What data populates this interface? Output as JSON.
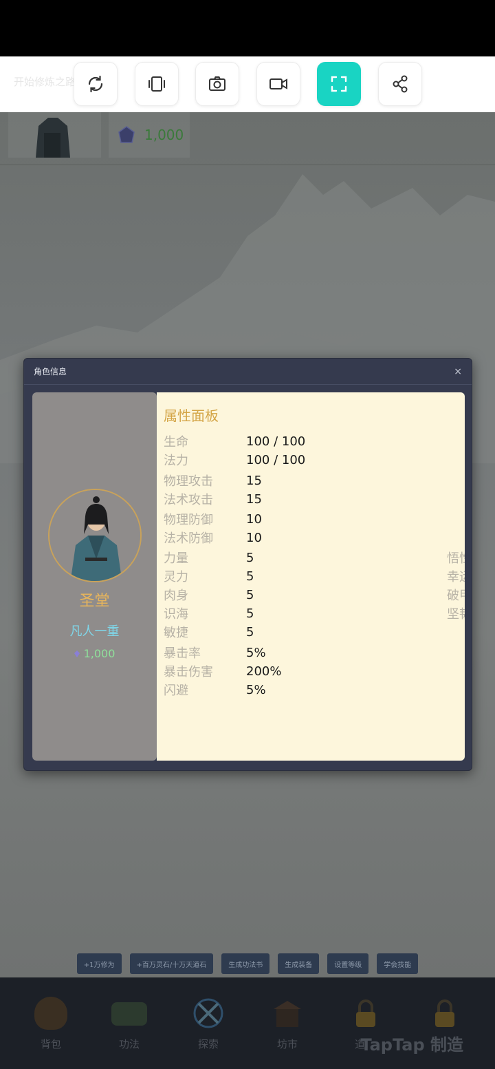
{
  "toolbar": {
    "ghost_text": "开始修炼之路",
    "buttons": [
      {
        "name": "refresh",
        "icon": "refresh-icon"
      },
      {
        "name": "rotate",
        "icon": "rotate-device-icon"
      },
      {
        "name": "screenshot",
        "icon": "camera-icon"
      },
      {
        "name": "record",
        "icon": "video-icon"
      },
      {
        "name": "fullscreen",
        "icon": "fullscreen-icon",
        "active": true
      },
      {
        "name": "share",
        "icon": "share-icon"
      }
    ],
    "accent": "#19d4c3"
  },
  "top_bar": {
    "currency_value": "1,000"
  },
  "modal": {
    "title": "角色信息",
    "close_glyph": "×",
    "character": {
      "name": "圣堂",
      "realm": "凡人一重",
      "spirit_stone": "1,000"
    },
    "panel_title": "属性面板",
    "stats": [
      {
        "label": "生命",
        "value": "100 / 100"
      },
      {
        "label": "法力",
        "value": "100 / 100"
      },
      {
        "label": "物理攻击",
        "value": "15"
      },
      {
        "label": "法术攻击",
        "value": "15"
      },
      {
        "label": "物理防御",
        "value": "10"
      },
      {
        "label": "法术防御",
        "value": "10"
      },
      {
        "label": "力量",
        "value": "5"
      },
      {
        "label": "灵力",
        "value": "5"
      },
      {
        "label": "肉身",
        "value": "5"
      },
      {
        "label": "识海",
        "value": "5"
      },
      {
        "label": "敏捷",
        "value": "5"
      },
      {
        "label": "暴击率",
        "value": "5%"
      },
      {
        "label": "暴击伤害",
        "value": "200%"
      },
      {
        "label": "闪避",
        "value": "5%"
      }
    ],
    "side_stats": [
      "悟性",
      "幸运",
      "破甲",
      "坚韧"
    ]
  },
  "cheat_buttons": [
    "+1万修为",
    "+百万灵石/十万天道石",
    "生成功法书",
    "生成装备",
    "设置等级",
    "学会技能"
  ],
  "bottom_nav": [
    {
      "label": "背包",
      "icon": "bag-icon"
    },
    {
      "label": "功法",
      "icon": "scroll-icon"
    },
    {
      "label": "探索",
      "icon": "crossed-swords-icon"
    },
    {
      "label": "坊市",
      "icon": "market-icon"
    },
    {
      "label": "道",
      "icon": "lock-icon"
    },
    {
      "label": "",
      "icon": "lock-icon"
    }
  ],
  "watermark": "TapTap 制造"
}
